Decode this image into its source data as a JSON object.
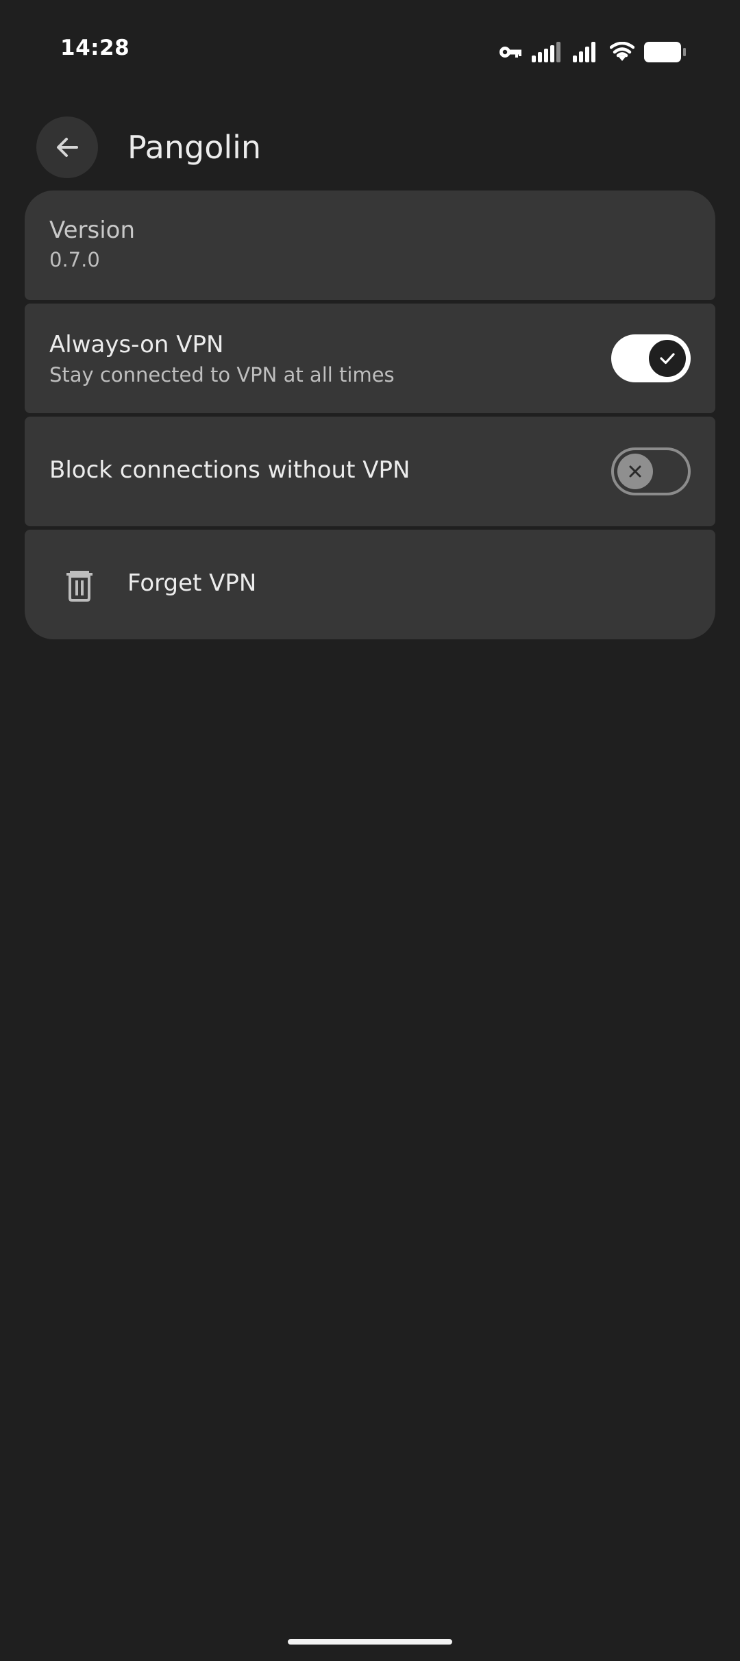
{
  "status_bar": {
    "time": "14:28",
    "icons": [
      "vpn-key-icon",
      "signal-icon",
      "signal-icon",
      "wifi-icon",
      "battery-icon"
    ]
  },
  "header": {
    "title": "Pangolin",
    "back_icon": "arrow-back-icon"
  },
  "settings": {
    "version": {
      "title": "Version",
      "value": "0.7.0"
    },
    "always_on": {
      "title": "Always-on VPN",
      "subtitle": "Stay connected to VPN at all times",
      "enabled": true
    },
    "block_connections": {
      "title": "Block connections without VPN",
      "enabled": false
    },
    "forget": {
      "label": "Forget VPN",
      "icon": "trash-icon"
    }
  },
  "colors": {
    "background": "#1f1f1f",
    "card": "#373737",
    "switch_on_track": "#ffffff",
    "switch_off_thumb": "#8f8f8f"
  }
}
